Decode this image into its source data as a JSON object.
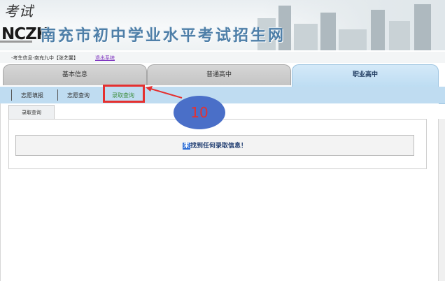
{
  "header": {
    "logo_script": "考试",
    "logo_mark": "NCZK",
    "site_title": "南充市初中学业水平考试招生网"
  },
  "userbar": {
    "user_text": "-考生信息-南充九中【张艺馨】",
    "logout_label": "退出系统"
  },
  "main_tabs": [
    {
      "label": "基本信息"
    },
    {
      "label": "普通高中"
    },
    {
      "label": "职业高中"
    }
  ],
  "sub_nav": [
    {
      "label": "志愿填报"
    },
    {
      "label": "志愿查询"
    },
    {
      "label": "录取查询"
    }
  ],
  "content": {
    "inner_tab_label": "录取查询",
    "message_first_char": "未",
    "message_rest": "找到任何录取信息！"
  },
  "annotation": {
    "step_number": "10"
  },
  "colors": {
    "active_tab": "#bcdcf2",
    "highlight_border": "#e53030",
    "step_circle": "#4a6fc8",
    "title_blue": "#4e7fa8"
  }
}
